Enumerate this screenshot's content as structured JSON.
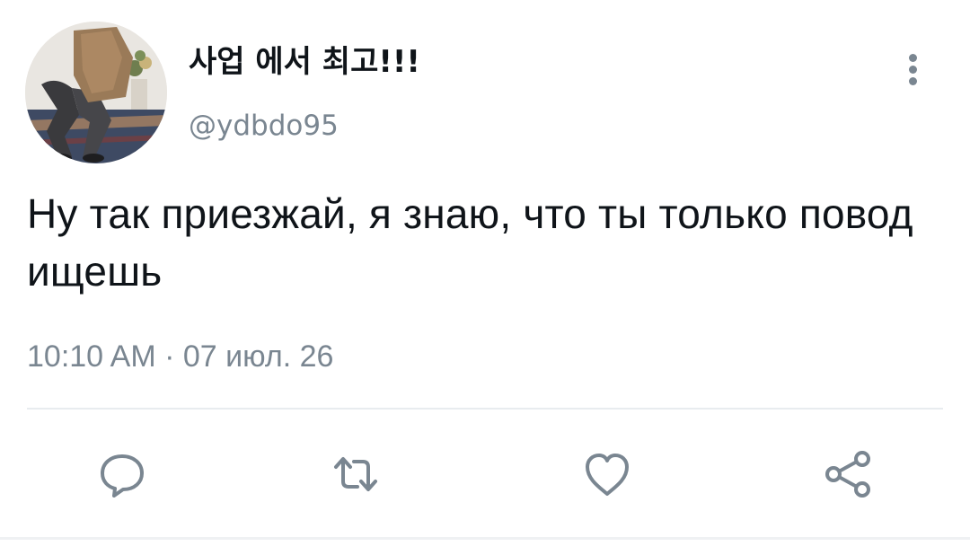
{
  "tweet": {
    "author": {
      "display_name": "사업 에서 최고!!!",
      "handle": "@ydbdo95"
    },
    "text": "Ну так приезжай, я знаю, что ты только повод ищешь",
    "timestamp": "10:10 AM · 07 июл. 26"
  },
  "actions": [
    {
      "name": "reply",
      "icon": "comment-icon"
    },
    {
      "name": "retweet",
      "icon": "retweet-icon"
    },
    {
      "name": "like",
      "icon": "heart-icon"
    },
    {
      "name": "share",
      "icon": "share-icon"
    }
  ],
  "colors": {
    "text_primary": "#0f1419",
    "text_secondary": "#7a8691",
    "icon": "#7a8691",
    "divider": "#e8ecef",
    "background": "#ffffff"
  }
}
